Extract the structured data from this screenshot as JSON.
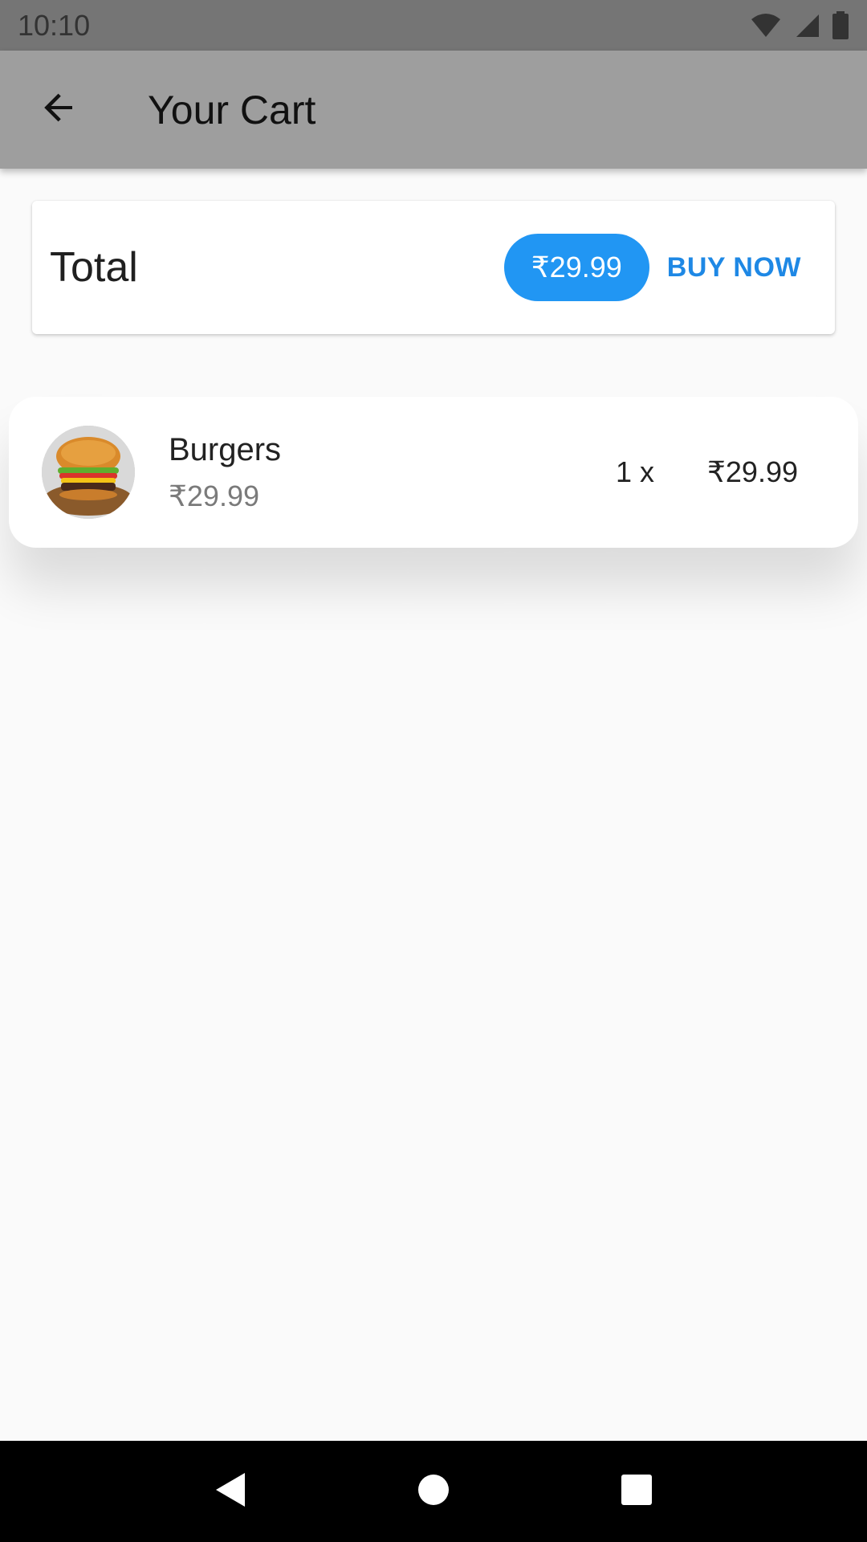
{
  "status_bar": {
    "time": "10:10",
    "icons": [
      "wifi-icon",
      "signal-icon",
      "battery-icon"
    ]
  },
  "app_bar": {
    "title": "Your Cart",
    "back_icon": "arrow-left-icon"
  },
  "total_card": {
    "label": "Total",
    "amount": "₹29.99",
    "buy_label": "BUY NOW"
  },
  "cart": {
    "items": [
      {
        "name": "Burgers",
        "unit_price": "₹29.99",
        "quantity": "1 x",
        "line_total": "₹29.99",
        "image": "burger-thumbnail"
      }
    ]
  },
  "nav_bar": {
    "icons": [
      "back-triangle-icon",
      "home-circle-icon",
      "recents-square-icon"
    ]
  },
  "colors": {
    "status_bar": "#757575",
    "app_bar": "#9e9e9e",
    "accent": "#2196f3",
    "buy_text": "#1e88e5",
    "background": "#fafafa"
  }
}
